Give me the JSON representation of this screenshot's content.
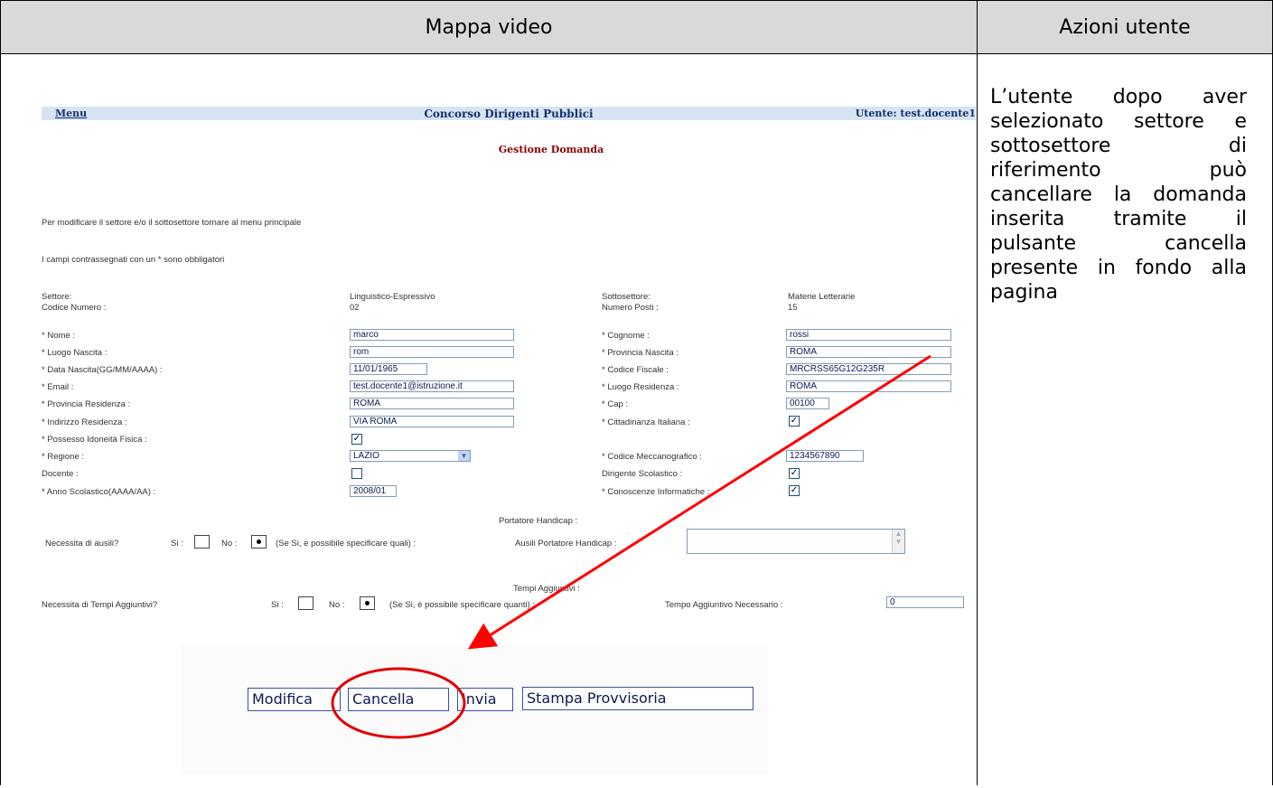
{
  "header": {
    "left_title": "Mappa video",
    "right_title": "Azioni utente"
  },
  "actions_text": "L’utente dopo aver selezionato settore e sottosettore di riferimento può cancellare la domanda inserita tramite il pulsante cancella presente in fondo alla pagina",
  "app": {
    "menu_link": "Menu",
    "title": "Concorso Dirigenti Pubblici",
    "user": "Utente: test.docente1",
    "page_title": "Gestione Domanda",
    "note_settore": "Per modificare il settore e/o il sottosettore tornare al menu principale",
    "note_required": "I campi contrassegnati con un * sono obbligatori"
  },
  "info": {
    "settore_label": "Settore:",
    "settore_value": "Linguistico-Espressivo",
    "codice_label": "Codice Numero :",
    "codice_value": "02",
    "sottosettore_label": "Sottosettore:",
    "sottosettore_value": "Materie Letterarie",
    "posti_label": "Numero Posti :",
    "posti_value": "15"
  },
  "form": {
    "nome_label": "* Nome :",
    "nome_value": "marco",
    "cognome_label": "* Cognome :",
    "cognome_value": "rossi",
    "luogo_nascita_label": "* Luogo Nascita :",
    "luogo_nascita_value": "rom",
    "prov_nascita_label": "* Provincia Nascita :",
    "prov_nascita_value": "ROMA",
    "data_nascita_label": "* Data Nascita(GG/MM/AAAA) :",
    "data_nascita_value": "11/01/1965",
    "cf_label": "* Codice Fiscale :",
    "cf_value": "MRCRSS65G12G235R",
    "email_label": "* Email :",
    "email_value": "test.docente1@istruzione.it",
    "luogo_res_label": "* Luogo Residenza :",
    "luogo_res_value": "ROMA",
    "prov_res_label": "* Provincia Residenza :",
    "prov_res_value": "ROMA",
    "cap_label": "* Cap :",
    "cap_value": "00100",
    "indirizzo_label": "* Indirizzo Residenza :",
    "indirizzo_value": "VIA ROMA",
    "cittadinanza_label": "* Cittadinanza Italiana :",
    "idoneita_label": "* Possesso Idoneità Fisica :",
    "regione_label": "* Regione :",
    "regione_value": "LAZIO",
    "meccanografico_label": "* Codice Meccanografico :",
    "meccanografico_value": "1234567890",
    "docente_label": "Docente :",
    "dirigente_label": "Dirigente Scolastico :",
    "anno_label": "* Anno Scolastico(AAAA/AA) :",
    "anno_value": "2008/01",
    "informatiche_label": "* Conoscenze Informatiche :",
    "checks": {
      "cittadinanza": true,
      "idoneita": true,
      "docente": false,
      "dirigente": true,
      "informatiche": true
    },
    "check_glyph": "✓"
  },
  "handicap": {
    "section_label": "Portatore Handicap :",
    "question": "Necessita di ausili?",
    "si_label": "Si :",
    "no_label": "No :",
    "hint": "(Se Si, è possibile specificare quali) :",
    "ausili_label": "Ausili Portatore Handicap :"
  },
  "tempi": {
    "section_label": "Tempi Aggiuntivi :",
    "question": "Necessita di Tempi Aggiuntivi?",
    "si_label": "Si :",
    "no_label": "No :",
    "hint": "(Se Si, è possibile specificare quanti) :",
    "tempo_label": "Tempo Aggiuntivo Necessario :",
    "tempo_value": "0"
  },
  "buttons": {
    "modifica": "Modifica",
    "cancella": "Cancella",
    "invia": "Invia",
    "stampa": "Stampa Provvisoria"
  },
  "annotation_color": "#ff0000"
}
